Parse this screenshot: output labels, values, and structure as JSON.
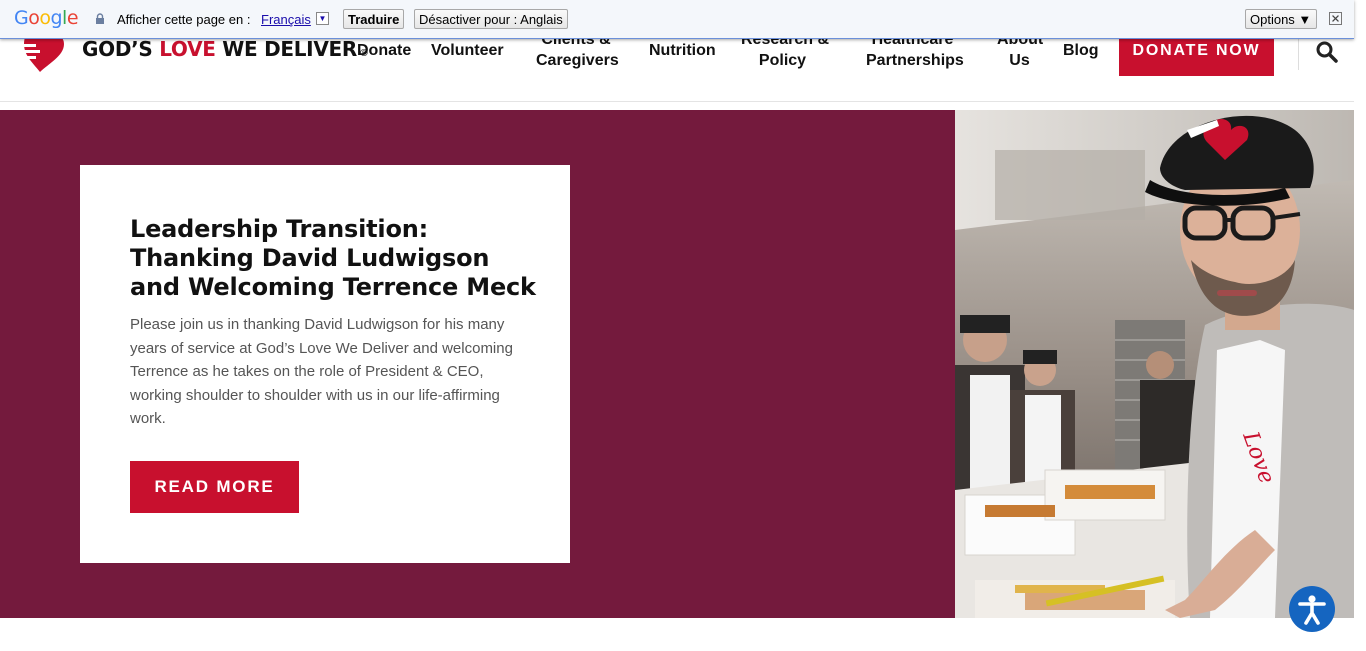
{
  "translate_bar": {
    "google_logo": "Google",
    "prompt": "Afficher cette page en :",
    "language": "Français",
    "translate_button": "Traduire",
    "disable_button": "Désactiver pour : Anglais",
    "options_button": "Options ▼"
  },
  "header": {
    "logo": {
      "part1": "GOD’S ",
      "part2": "LOVE",
      "part3": " WE DELIVER",
      "reg": "®"
    },
    "nav": {
      "donate": "Donate",
      "volunteer": "Volunteer",
      "clients_line1": "Clients &",
      "clients_line2": "Caregivers",
      "nutrition": "Nutrition",
      "research_line1": "Research &",
      "research_line2": "Policy",
      "healthcare_line1": "Healthcare",
      "healthcare_line2": "Partnerships",
      "about_line1": "About",
      "about_line2": "Us",
      "blog": "Blog"
    },
    "cta": "DONATE NOW",
    "search_icon": "search-icon"
  },
  "hero": {
    "title": "Leadership Transition: Thanking David Ludwigson and Welcoming Terrence Meck",
    "body": "Please join us in thanking David Ludwigson for his many years of service at God’s Love We Deliver and welcoming Terrence as he takes on the role of President & CEO, working shoulder to shoulder with us in our life-affirming work.",
    "button": "READ MORE",
    "background_color": "#741a3d",
    "accent_color": "#c8102e"
  },
  "accessibility_icon": "accessibility-icon"
}
